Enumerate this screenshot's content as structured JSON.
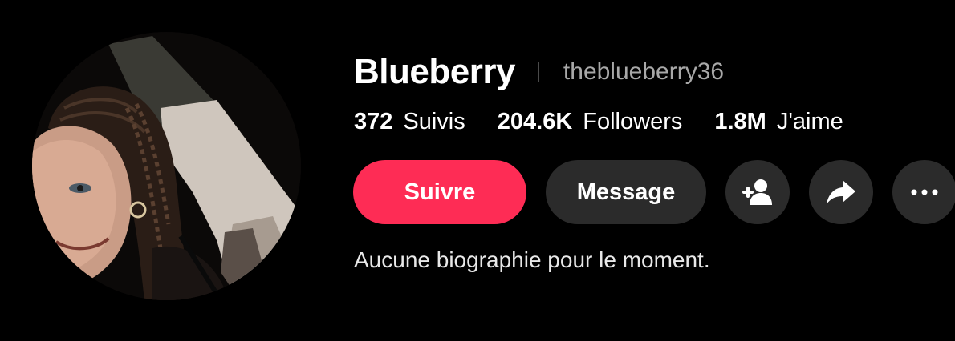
{
  "profile": {
    "display_name": "Blueberry",
    "username": "theblueberry36",
    "avatar_alt": "profile photo"
  },
  "stats": [
    {
      "value": "372",
      "label": "Suivis"
    },
    {
      "value": "204.6K",
      "label": "Followers"
    },
    {
      "value": "1.8M",
      "label": "J'aime"
    }
  ],
  "actions": {
    "follow_label": "Suivre",
    "message_label": "Message",
    "add_friend_icon": "person-plus-icon",
    "share_icon": "share-arrow-icon",
    "more_icon": "more-horizontal-icon"
  },
  "bio": "Aucune biographie pour le moment.",
  "colors": {
    "background": "#000000",
    "follow_button": "#fe2c55",
    "secondary_button": "#2b2b2b",
    "username_text": "#a8a8a8"
  }
}
